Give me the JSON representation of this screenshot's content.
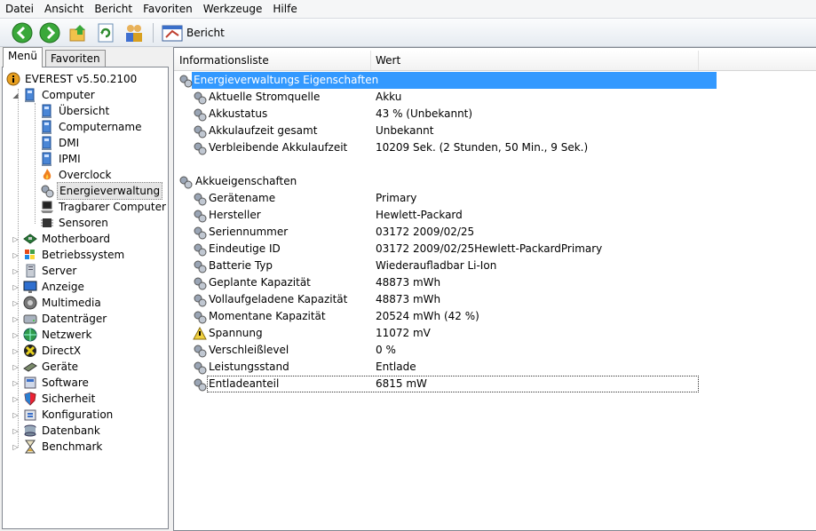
{
  "menubar": {
    "items": [
      "Datei",
      "Ansicht",
      "Bericht",
      "Favoriten",
      "Werkzeuge",
      "Hilfe"
    ]
  },
  "toolbar": {
    "buttons": [
      {
        "icon": "back-arrow-icon",
        "color": "#2e9a2e"
      },
      {
        "icon": "forward-arrow-icon",
        "color": "#2e9a2e"
      },
      {
        "icon": "up-folder-icon",
        "color": "#e0b030"
      },
      {
        "icon": "refresh-icon",
        "color": "#3a8a3a"
      },
      {
        "icon": "users-icon",
        "color": "#d89a30"
      }
    ],
    "report_label": "Bericht"
  },
  "left": {
    "tabs": [
      "Menü",
      "Favoriten"
    ],
    "tree": [
      {
        "label": "EVEREST v5.50.2100",
        "icon": "info-icon"
      },
      {
        "label": "Computer",
        "icon": "computer-icon"
      },
      {
        "label": "Übersicht",
        "icon": "computer-icon"
      },
      {
        "label": "Computername",
        "icon": "computer-icon"
      },
      {
        "label": "DMI",
        "icon": "computer-icon"
      },
      {
        "label": "IPMI",
        "icon": "computer-icon"
      },
      {
        "label": "Overclock",
        "icon": "flame-icon"
      },
      {
        "label": "Energieverwaltung",
        "icon": "power-plug-icon"
      },
      {
        "label": "Tragbarer Computer",
        "icon": "laptop-icon"
      },
      {
        "label": "Sensoren",
        "icon": "chip-icon"
      },
      {
        "label": "Motherboard",
        "icon": "motherboard-icon"
      },
      {
        "label": "Betriebssystem",
        "icon": "windows-flag-icon"
      },
      {
        "label": "Server",
        "icon": "server-icon"
      },
      {
        "label": "Anzeige",
        "icon": "monitor-icon"
      },
      {
        "label": "Multimedia",
        "icon": "speaker-icon"
      },
      {
        "label": "Datenträger",
        "icon": "disk-icon"
      },
      {
        "label": "Netzwerk",
        "icon": "globe-icon"
      },
      {
        "label": "DirectX",
        "icon": "directx-icon"
      },
      {
        "label": "Geräte",
        "icon": "devices-icon"
      },
      {
        "label": "Software",
        "icon": "software-icon"
      },
      {
        "label": "Sicherheit",
        "icon": "shield-icon"
      },
      {
        "label": "Konfiguration",
        "icon": "config-icon"
      },
      {
        "label": "Datenbank",
        "icon": "database-icon"
      },
      {
        "label": "Benchmark",
        "icon": "hourglass-icon"
      }
    ]
  },
  "table": {
    "headers": [
      "Informationsliste",
      "Wert"
    ],
    "section1": "Energieverwaltungs Eigenschaften",
    "rows1": [
      {
        "k": "Aktuelle Stromquelle",
        "v": "Akku"
      },
      {
        "k": "Akkustatus",
        "v": "43 % (Unbekannt)"
      },
      {
        "k": "Akkulaufzeit gesamt",
        "v": "Unbekannt"
      },
      {
        "k": "Verbleibende Akkulaufzeit",
        "v": "10209 Sek. (2 Stunden, 50 Min., 9 Sek.)"
      }
    ],
    "section2": "Akkueigenschaften",
    "rows2": [
      {
        "k": "Gerätename",
        "v": "Primary"
      },
      {
        "k": "Hersteller",
        "v": "Hewlett-Packard"
      },
      {
        "k": "Seriennummer",
        "v": "03172 2009/02/25"
      },
      {
        "k": "Eindeutige ID",
        "v": "03172 2009/02/25Hewlett-PackardPrimary"
      },
      {
        "k": "Batterie Typ",
        "v": "Wiederaufladbar Li-Ion"
      },
      {
        "k": "Geplante Kapazität",
        "v": "48873 mWh"
      },
      {
        "k": "Vollaufgeladene Kapazität",
        "v": "48873 mWh"
      },
      {
        "k": "Momentane Kapazität",
        "v": "20524 mWh  (42 %)"
      },
      {
        "k": "Spannung",
        "v": "11072 mV"
      },
      {
        "k": "Verschleißlevel",
        "v": "0 %"
      },
      {
        "k": "Leistungsstand",
        "v": "Entlade"
      },
      {
        "k": "Entladeanteil",
        "v": "6815 mW"
      }
    ]
  },
  "colors": {
    "selection": "#3399ff",
    "accent": "#2e9a2e"
  }
}
